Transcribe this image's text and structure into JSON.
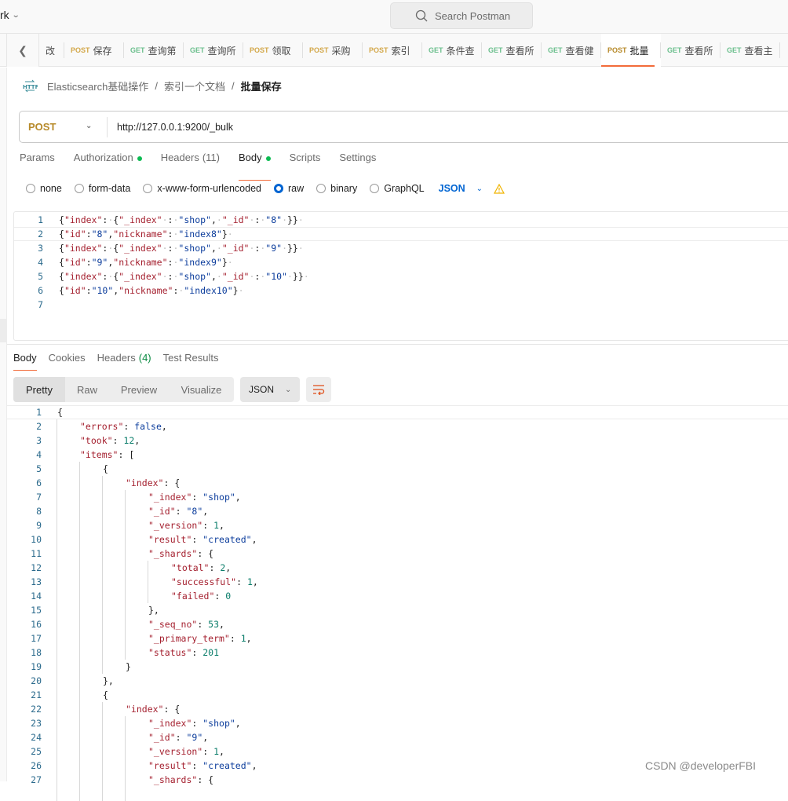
{
  "topbar": {
    "workspace_label": "rk",
    "search_placeholder": "Search Postman"
  },
  "tabs": [
    {
      "method": "",
      "name": "改"
    },
    {
      "method": "POST",
      "name": "保存"
    },
    {
      "method": "GET",
      "name": "查询第"
    },
    {
      "method": "GET",
      "name": "查询所"
    },
    {
      "method": "POST",
      "name": "领取"
    },
    {
      "method": "POST",
      "name": "采购"
    },
    {
      "method": "POST",
      "name": "索引"
    },
    {
      "method": "GET",
      "name": "条件查"
    },
    {
      "method": "GET",
      "name": "查看所"
    },
    {
      "method": "GET",
      "name": "查看健"
    },
    {
      "method": "POST",
      "name": "批量",
      "active": true
    },
    {
      "method": "GET",
      "name": "查看所"
    },
    {
      "method": "GET",
      "name": "查看主"
    }
  ],
  "breadcrumb": {
    "icon": "http-icon",
    "items": [
      "Elasticsearch基础操作",
      "索引一个文档"
    ],
    "current": "批量保存",
    "separator": "/"
  },
  "request": {
    "method": "POST",
    "url": "http://127.0.0.1:9200/_bulk"
  },
  "request_tabs": [
    {
      "label": "Params"
    },
    {
      "label": "Authorization",
      "dot": true
    },
    {
      "label": "Headers",
      "count": "(11)"
    },
    {
      "label": "Body",
      "dot": true,
      "active": true
    },
    {
      "label": "Scripts"
    },
    {
      "label": "Settings"
    }
  ],
  "body_options": {
    "radios": [
      {
        "label": "none",
        "selected": false
      },
      {
        "label": "form-data",
        "selected": false
      },
      {
        "label": "x-www-form-urlencoded",
        "selected": false
      },
      {
        "label": "raw",
        "selected": true
      },
      {
        "label": "binary",
        "selected": false
      },
      {
        "label": "GraphQL",
        "selected": false
      }
    ],
    "language": "JSON"
  },
  "request_body_lines": [
    "{\"index\": {\"_index\" : \"shop\", \"_id\" : \"8\" }}",
    "{\"id\":\"8\",\"nickname\": \"index8\"}",
    "{\"index\": {\"_index\" : \"shop\", \"_id\" : \"9\" }}",
    "{\"id\":\"9\",\"nickname\": \"index9\"}",
    "{\"index\": {\"_index\" : \"shop\", \"_id\" : \"10\" }}",
    "{\"id\":\"10\",\"nickname\": \"index10\"}",
    ""
  ],
  "response_tabs": [
    {
      "label": "Body",
      "active": true
    },
    {
      "label": "Cookies"
    },
    {
      "label": "Headers",
      "count": "(4)"
    },
    {
      "label": "Test Results"
    }
  ],
  "view_options": [
    "Pretty",
    "Raw",
    "Preview",
    "Visualize"
  ],
  "view_active": "Pretty",
  "response_format": "JSON",
  "response_lines": [
    {
      "indent": 0,
      "text": "{"
    },
    {
      "indent": 1,
      "key": "errors",
      "val": "false",
      "type": "kw",
      "comma": true
    },
    {
      "indent": 1,
      "key": "took",
      "val": "12",
      "type": "nm",
      "comma": true
    },
    {
      "indent": 1,
      "key": "items",
      "open": "["
    },
    {
      "indent": 2,
      "text": "{"
    },
    {
      "indent": 3,
      "key": "index",
      "open": "{"
    },
    {
      "indent": 4,
      "key": "_index",
      "val": "\"shop\"",
      "type": "s",
      "comma": true
    },
    {
      "indent": 4,
      "key": "_id",
      "val": "\"8\"",
      "type": "s",
      "comma": true
    },
    {
      "indent": 4,
      "key": "_version",
      "val": "1",
      "type": "nm",
      "comma": true
    },
    {
      "indent": 4,
      "key": "result",
      "val": "\"created\"",
      "type": "s",
      "comma": true
    },
    {
      "indent": 4,
      "key": "_shards",
      "open": "{"
    },
    {
      "indent": 5,
      "key": "total",
      "val": "2",
      "type": "nm",
      "comma": true
    },
    {
      "indent": 5,
      "key": "successful",
      "val": "1",
      "type": "nm",
      "comma": true
    },
    {
      "indent": 5,
      "key": "failed",
      "val": "0",
      "type": "nm"
    },
    {
      "indent": 4,
      "text": "},"
    },
    {
      "indent": 4,
      "key": "_seq_no",
      "val": "53",
      "type": "nm",
      "comma": true
    },
    {
      "indent": 4,
      "key": "_primary_term",
      "val": "1",
      "type": "nm",
      "comma": true
    },
    {
      "indent": 4,
      "key": "status",
      "val": "201",
      "type": "nm"
    },
    {
      "indent": 3,
      "text": "}"
    },
    {
      "indent": 2,
      "text": "},"
    },
    {
      "indent": 2,
      "text": "{"
    },
    {
      "indent": 3,
      "key": "index",
      "open": "{"
    },
    {
      "indent": 4,
      "key": "_index",
      "val": "\"shop\"",
      "type": "s",
      "comma": true
    },
    {
      "indent": 4,
      "key": "_id",
      "val": "\"9\"",
      "type": "s",
      "comma": true
    },
    {
      "indent": 4,
      "key": "_version",
      "val": "1",
      "type": "nm",
      "comma": true
    },
    {
      "indent": 4,
      "key": "result",
      "val": "\"created\"",
      "type": "s",
      "comma": true
    },
    {
      "indent": 4,
      "key": "_shards",
      "open": "{"
    }
  ],
  "watermark": "CSDN @developerFBI",
  "colors": {
    "accent": "#f26b3a",
    "post": "#d3a84a",
    "get": "#6bbf8d",
    "selected_radio": "#0265d2",
    "status_dot": "#0cbb52"
  }
}
